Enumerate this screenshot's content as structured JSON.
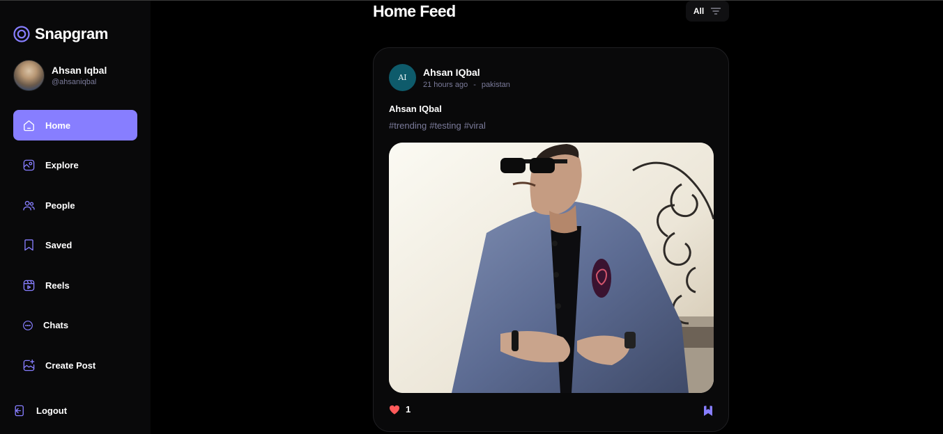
{
  "app": {
    "name": "Snapgram",
    "accent": "#877eff"
  },
  "user": {
    "name": "Ahsan Iqbal",
    "handle": "@ahsaniqbal"
  },
  "nav": {
    "items": [
      {
        "label": "Home",
        "icon": "home-icon",
        "active": true
      },
      {
        "label": "Explore",
        "icon": "explore-icon"
      },
      {
        "label": "People",
        "icon": "people-icon"
      },
      {
        "label": "Saved",
        "icon": "bookmark-icon"
      },
      {
        "label": "Reels",
        "icon": "reels-icon"
      },
      {
        "label": "Chats",
        "icon": "chat-icon"
      },
      {
        "label": "Create Post",
        "icon": "create-post-icon"
      }
    ],
    "logout_label": "Logout"
  },
  "feed": {
    "title": "Home Feed",
    "filter_label": "All",
    "post": {
      "author_initials": "AI",
      "author_name": "Ahsan IQbal",
      "time": "21 hours ago",
      "separator": "-",
      "location": "pakistan",
      "caption": "Ahsan IQbal",
      "tags": [
        "#trending",
        "#testing",
        "#viral"
      ],
      "likes": "1",
      "like_color": "#ff5a5a"
    }
  }
}
